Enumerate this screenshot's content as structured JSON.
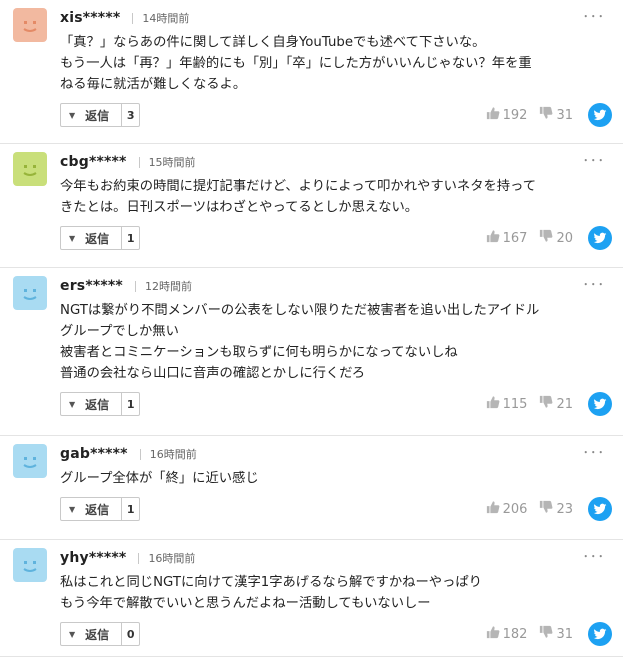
{
  "labels": {
    "reply": "返信",
    "more": "･･･"
  },
  "colors": {
    "twitter": "#1da1f2"
  },
  "comments": [
    {
      "user": "xis*****",
      "time": "14時間前",
      "avatar_color": "#f2b9a0",
      "avatar_face": "#e48a66",
      "lines": [
        "「真？」ならあの件に関して詳しく自身YouTubeでも述べて下さいな。",
        "もう一人は「再？」年齢的にも「別」「卒」にした方がいいんじゃない？年を重",
        "ねる毎に就活が難しくなるよ。"
      ],
      "replies": "3",
      "likes": "192",
      "dislikes": "31"
    },
    {
      "user": "cbg*****",
      "time": "15時間前",
      "avatar_color": "#c9df7a",
      "avatar_face": "#97b43a",
      "lines": [
        "今年もお約束の時間に提灯記事だけど、よりによって叩かれやすいネタを持って",
        "きたとは。日刊スポーツはわざとやってるとしか思えない。"
      ],
      "replies": "1",
      "likes": "167",
      "dislikes": "20"
    },
    {
      "user": "ers*****",
      "time": "12時間前",
      "avatar_color": "#a9dbf2",
      "avatar_face": "#5fb3dd",
      "lines": [
        "NGTは繋がり不問メンバーの公表をしない限りただ被害者を追い出したアイドル",
        "グループでしか無い",
        "被害者とコミニケーションも取らずに何も明らかになってないしね",
        "普通の会社なら山口に音声の確認とかしに行くだろ"
      ],
      "replies": "1",
      "likes": "115",
      "dislikes": "21"
    },
    {
      "user": "gab*****",
      "time": "16時間前",
      "avatar_color": "#a9dbf2",
      "avatar_face": "#5fb3dd",
      "lines": [
        "グループ全体が「終」に近い感じ"
      ],
      "replies": "1",
      "likes": "206",
      "dislikes": "23"
    },
    {
      "user": "yhy*****",
      "time": "16時間前",
      "avatar_color": "#a9dbf2",
      "avatar_face": "#5fb3dd",
      "lines": [
        "私はこれと同じNGTに向けて漢字1字あげるなら解ですかねーやっぱり",
        "もう今年で解散でいいと思うんだよねー活動してもいないしー"
      ],
      "replies": "0",
      "likes": "182",
      "dislikes": "31"
    }
  ]
}
